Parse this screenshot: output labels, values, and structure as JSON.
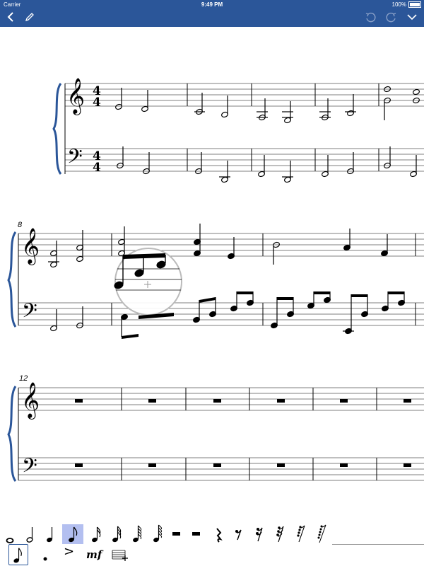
{
  "status_bar": {
    "carrier": "Carrier",
    "time": "9:49 PM",
    "battery": "100%"
  },
  "toolbar": {
    "icons": [
      "chevron-left-icon",
      "pencil-icon",
      "undo-icon",
      "redo-icon",
      "chevron-down-icon"
    ]
  },
  "score": {
    "systems": [
      {
        "measure_number": ""
      },
      {
        "measure_number": "8"
      },
      {
        "measure_number": "12"
      }
    ],
    "time_signature": {
      "top": "4",
      "bottom": "4"
    },
    "clefs": {
      "treble": "𝄞",
      "bass": "𝄢"
    }
  },
  "palette": {
    "selected_index": 3,
    "row1": [
      "whole-note-icon",
      "half-note-icon",
      "quarter-note-icon",
      "eighth-note-icon",
      "sixteenth-note-icon",
      "thirty-second-note-icon",
      "sixty-fourth-note-icon",
      "one-twenty-eighth-note-icon",
      "whole-rest-icon",
      "half-rest-icon",
      "quarter-rest-icon",
      "eighth-rest-icon",
      "sixteenth-rest-icon",
      "thirty-second-rest-icon",
      "sixty-fourth-rest-icon",
      "one-twenty-eighth-rest-icon"
    ],
    "row2": [
      {
        "icon": "eighth-note-boxed-icon",
        "label": ""
      },
      {
        "icon": "dot-icon",
        "label": ""
      },
      {
        "icon": "accent-icon",
        "label": ">"
      },
      {
        "icon": "dynamic-icon",
        "label": "mf"
      },
      {
        "icon": "add-measure-icon",
        "label": ""
      }
    ]
  },
  "colors": {
    "toolbar": "#2b5699",
    "brace": "#2b5699",
    "selection": "#b3bff0"
  }
}
